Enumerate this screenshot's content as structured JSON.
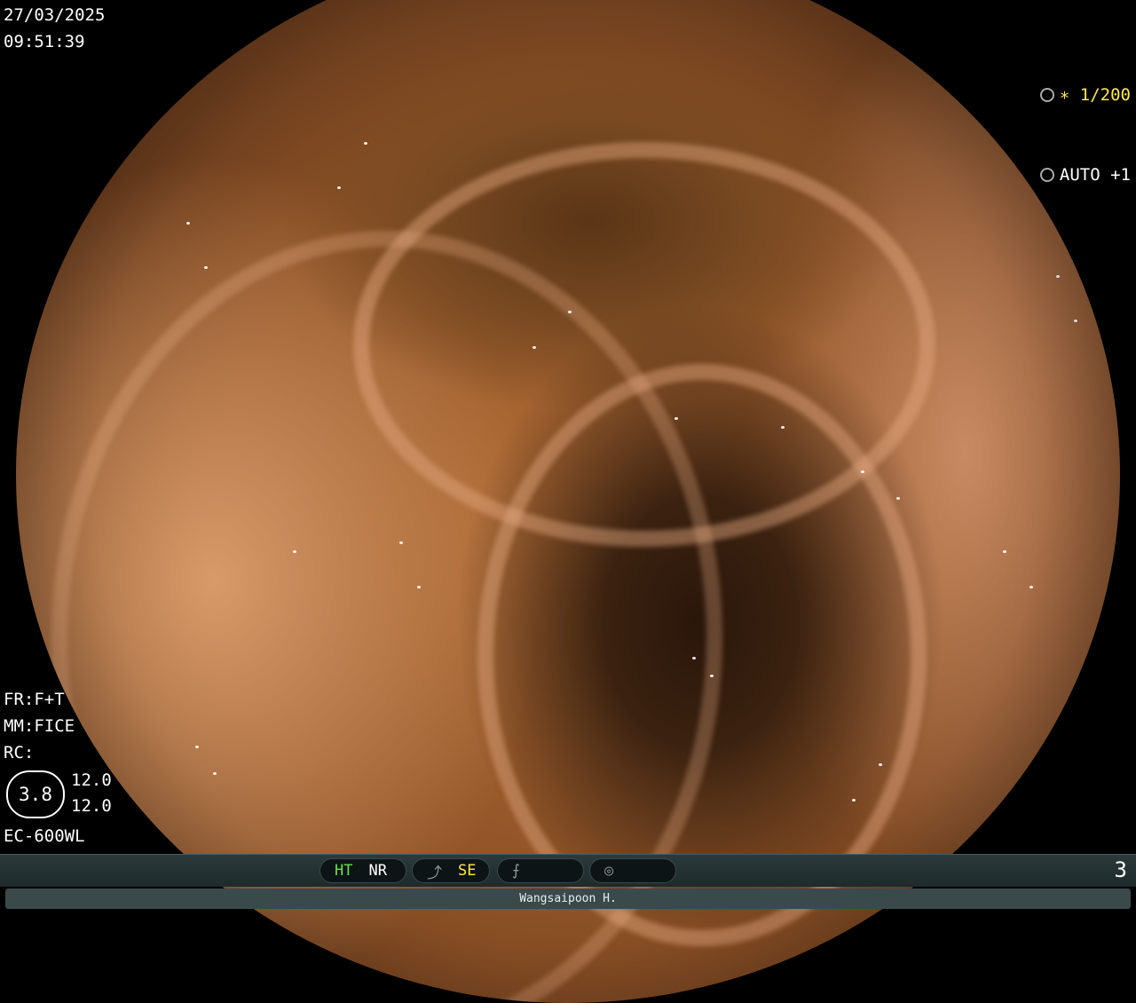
{
  "datetime": {
    "date": "27/03/2025",
    "time": "09:51:39"
  },
  "top_right": {
    "shutter_icon": "aperture-icon",
    "shutter_value": "∗ 1/200",
    "iris_icon": "iris-icon",
    "iris_value": "AUTO +1",
    "shutter_color": "#ffe84a"
  },
  "settings": {
    "fr": "FR:F+T",
    "mm": "MM:FICE",
    "rc": "RC:",
    "badge": "3.8",
    "val1": "12.0",
    "val2": "12.0",
    "model": "EC-600WL"
  },
  "status_bar": {
    "ht": "HT",
    "nr": "NR",
    "se": "SE",
    "page": "3"
  },
  "footer": {
    "operator": "Wangsaipoon H."
  }
}
